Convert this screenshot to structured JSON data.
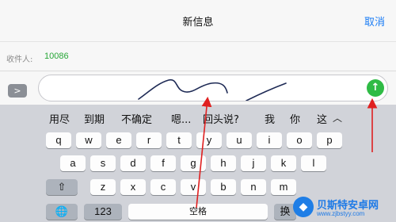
{
  "header": {
    "title": "新信息",
    "cancel_label": "取消"
  },
  "recipient": {
    "label": "收件人:",
    "value": "10086"
  },
  "compose": {
    "expand_icon": "chevron-right-icon",
    "send_icon": "arrow-up-icon",
    "send_color": "#2fbb45"
  },
  "suggestions": [
    "用尽",
    "到期",
    "不确定",
    "嗯...",
    "回头说?",
    "我",
    "你",
    "这"
  ],
  "keyboard": {
    "row1": [
      "q",
      "w",
      "e",
      "r",
      "t",
      "y",
      "u",
      "i",
      "o",
      "p"
    ],
    "row2": [
      "a",
      "s",
      "d",
      "f",
      "g",
      "h",
      "j",
      "k",
      "l"
    ],
    "row3": [
      "z",
      "x",
      "c",
      "v",
      "b",
      "n",
      "m"
    ],
    "shift_icon": "shift-icon",
    "globe_icon": "globe-icon",
    "numbers_label": "123",
    "space_label": "空格",
    "switch_label": "换"
  },
  "annotations": {
    "arrow_color": "#e02020"
  },
  "watermark": {
    "name": "贝斯特安卓网",
    "url": "www.zjbstyy.com"
  }
}
